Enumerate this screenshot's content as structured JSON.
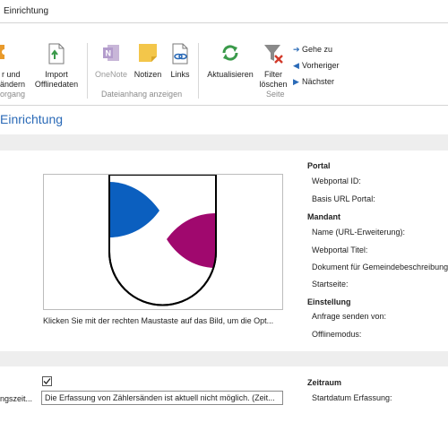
{
  "window": {
    "title": "Einrichtung"
  },
  "ribbon": {
    "vorgang": {
      "button1_label_line1": "r und",
      "button1_label_line2": "ändern",
      "group_label": "organg"
    },
    "import_button": {
      "line1": "Import",
      "line2": "Offlinedaten"
    },
    "dateianhang": {
      "onenote": "OneNote",
      "notizen": "Notizen",
      "links": "Links",
      "group_label": "Dateianhang anzeigen"
    },
    "seite": {
      "aktualisieren": "Aktualisieren",
      "filter_line1": "Filter",
      "filter_line2": "löschen",
      "goto": "Gehe zu",
      "previous": "Vorheriger",
      "next": "Nächster",
      "group_label": "Seite"
    }
  },
  "page": {
    "title": "Einrichtung"
  },
  "image_section": {
    "caption": "Klicken Sie mit der rechten Maustaste auf das Bild, um die Opt..."
  },
  "portal": {
    "header": "Portal",
    "fields": [
      "Webportal ID:",
      "Basis URL Portal:"
    ]
  },
  "mandant": {
    "header": "Mandant",
    "fields": [
      "Name (URL-Erweiterung):",
      "Webportal Titel:",
      "Dokument für Gemeindebeschreibung",
      "Startseite:"
    ]
  },
  "einstellung": {
    "header": "Einstellung",
    "fields": [
      "Anfrage senden von:",
      "Offlinemodus:"
    ]
  },
  "erfassung": {
    "label": "ngszeit...",
    "checkbox_checked": true,
    "text_value": "Die Erfassung von Zählersänden ist aktuell nicht möglich. (Zeit..."
  },
  "zeitraum": {
    "header": "Zeitraum",
    "fields": [
      "Startdatum Erfassung:"
    ]
  },
  "colors": {
    "accent": "#2a6ab7",
    "shield_blue": "#0b5fbf",
    "shield_magenta": "#a0086e"
  }
}
